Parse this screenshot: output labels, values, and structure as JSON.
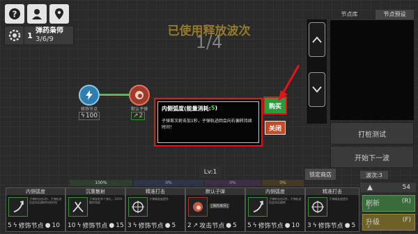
{
  "top_icons": {
    "help": "question-icon",
    "profile": "person-icon",
    "map": "map-pin-icon"
  },
  "tower": {
    "level": "1",
    "name": "弹药枭师",
    "stats": "3/6/9"
  },
  "wave_banner": {
    "title": "已使用释放波次",
    "count": "1/4"
  },
  "nodes": {
    "left": {
      "label": "修饰节点",
      "stat": "100"
    },
    "right": {
      "label": "默认子弹",
      "stat": "2"
    }
  },
  "tooltip": {
    "title_prefix": "内侧弧度(能量消耗:",
    "cost": "5",
    "title_suffix": ")",
    "description": "子弹首次射击加1秒，子弹轨迹回会向右偏转持续时间！"
  },
  "buttons": {
    "buy": "购买",
    "close": "关闭",
    "tab_library": "节点库",
    "tab_preset": "节点预设",
    "test": "打桩测试",
    "next_wave": "开始下一波",
    "lock_shop": "锁定商店",
    "refresh": "刷新",
    "refresh_key": "(R)",
    "refresh_cost": "3",
    "upgrade": "升级",
    "upgrade_key": "(F)",
    "upgrade_cost": "2"
  },
  "level": "Lv:1",
  "progress": [
    {
      "label": "100%",
      "color": "#5a9a5a"
    },
    {
      "label": "0%",
      "color": "#5a7acc"
    },
    {
      "label": "0%",
      "color": "#a050c0"
    },
    {
      "label": "0%",
      "color": "#c89a30"
    }
  ],
  "wave_badge": "波次:3",
  "gold": "54",
  "cards": [
    {
      "title": "内侧弧度",
      "desc": "子弹射击加1秒，子弹轨迹回会向右偏转持续时间",
      "cost": "5",
      "type": "修饰节点",
      "val": "10",
      "icon": "curve-icon"
    },
    {
      "title": "沉重散射",
      "desc": "子弹发射多个弹丸，100%散射角度",
      "cost": "10",
      "type": "修饰节点",
      "val": "15",
      "icon": "split-arrows-icon"
    },
    {
      "title": "精准打击",
      "desc": "子弹精准度提升",
      "cost": "3",
      "type": "修饰节点",
      "val": "5",
      "icon": "crosshair-icon"
    },
    {
      "title": "默认子弹",
      "desc": "[弹药枭师]",
      "cost": "2",
      "type": "攻击节点",
      "val": "5",
      "icon": "bullet-icon"
    },
    {
      "title": "内侧弧度",
      "desc": "子弹射击加1秒，子弹轨迹回会向右偏转",
      "cost": "5",
      "type": "修饰节点",
      "val": "10",
      "icon": "curve-icon"
    },
    {
      "title": "精准打击",
      "desc": "子弹精准度提升",
      "cost": "3",
      "type": "修饰节点",
      "val": "5",
      "icon": "crosshair-icon"
    }
  ],
  "colors": {
    "accent_red": "#e0161b",
    "buy_green": "#2e9a3d",
    "close_orange": "#c44a28",
    "wave_gold": "#ebb928"
  }
}
